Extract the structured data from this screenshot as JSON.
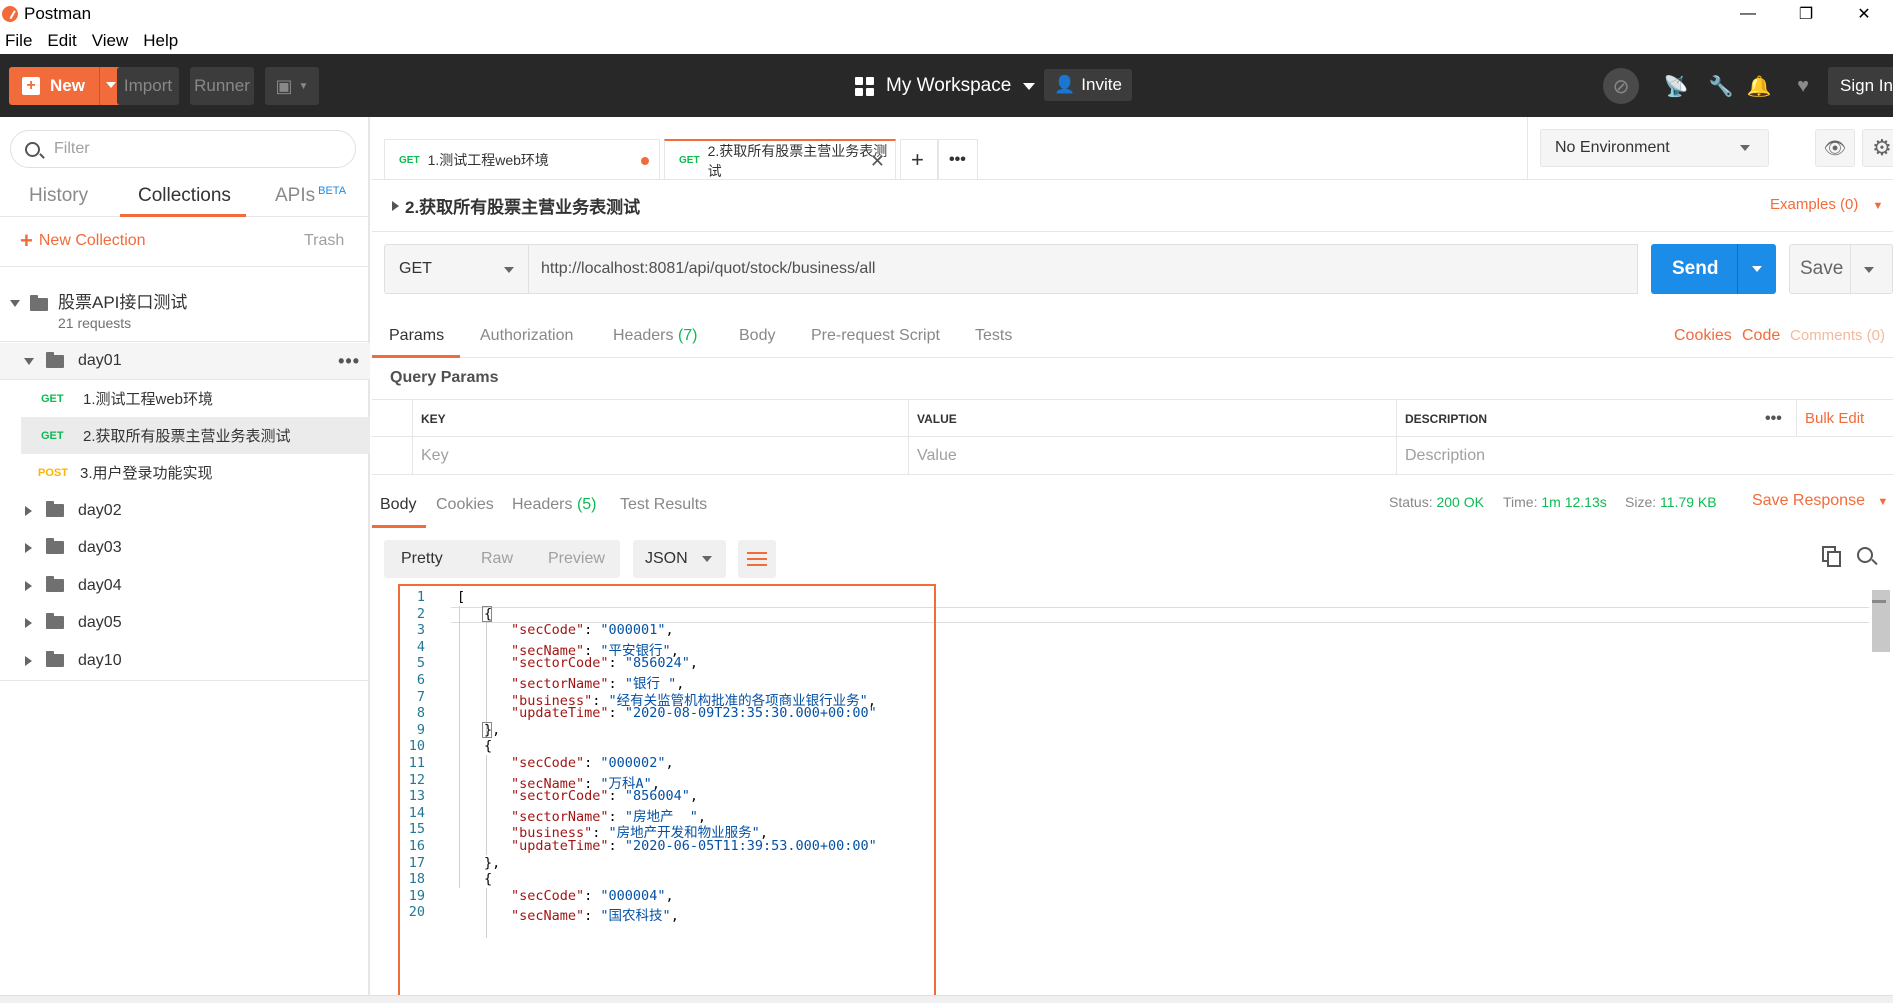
{
  "window": {
    "title": "Postman",
    "minimize": "—",
    "restore": "❐",
    "close": "✕"
  },
  "menu": [
    "File",
    "Edit",
    "View",
    "Help"
  ],
  "header": {
    "new_label": "New",
    "import_label": "Import",
    "runner_label": "Runner",
    "workspace_label": "My Workspace",
    "invite_label": "Invite",
    "signin_label": "Sign In"
  },
  "sidebar": {
    "filter_placeholder": "Filter",
    "tabs": [
      "History",
      "Collections",
      "APIs"
    ],
    "beta_badge": "BETA",
    "new_collection_label": "New Collection",
    "trash_label": "Trash",
    "collection": {
      "name": "股票API接口测试",
      "count": "21 requests"
    },
    "folders": [
      {
        "name": "day01",
        "expanded": true,
        "requests": [
          {
            "method": "GET",
            "name": "1.测试工程web环境"
          },
          {
            "method": "GET",
            "name": "2.获取所有股票主营业务表测试"
          },
          {
            "method": "POST",
            "name": "3.用户登录功能实现"
          }
        ]
      },
      {
        "name": "day02"
      },
      {
        "name": "day03"
      },
      {
        "name": "day04"
      },
      {
        "name": "day05"
      },
      {
        "name": "day10"
      }
    ]
  },
  "tabs": [
    {
      "method": "GET",
      "label": "1.测试工程web环境",
      "unsaved": true
    },
    {
      "method": "GET",
      "label": "2.获取所有股票主营业务表测试",
      "active": true
    }
  ],
  "environment": {
    "selected": "No Environment"
  },
  "request": {
    "name": "2.获取所有股票主营业务表测试",
    "examples_label": "Examples (0)",
    "method": "GET",
    "url": "http://localhost:8081/api/quot/stock/business/all",
    "send_label": "Send",
    "save_label": "Save",
    "tabs": [
      "Params",
      "Authorization",
      "Headers",
      "Body",
      "Pre-request Script",
      "Tests"
    ],
    "headers_count": "(7)",
    "right_links": [
      "Cookies",
      "Code",
      "Comments (0)"
    ],
    "query_params_title": "Query Params",
    "columns": [
      "KEY",
      "VALUE",
      "DESCRIPTION"
    ],
    "bulk_edit": "Bulk Edit",
    "placeholders": [
      "Key",
      "Value",
      "Description"
    ]
  },
  "response": {
    "tabs": [
      "Body",
      "Cookies",
      "Headers",
      "Test Results"
    ],
    "headers_count": "(5)",
    "status_label": "Status:",
    "status_value": "200 OK",
    "time_label": "Time:",
    "time_value": "1m 12.13s",
    "size_label": "Size:",
    "size_value": "11.79 KB",
    "save_response": "Save Response",
    "formats": [
      "Pretty",
      "Raw",
      "Preview"
    ],
    "language": "JSON",
    "lines": [
      {
        "n": "1",
        "i": 0,
        "t": "["
      },
      {
        "n": "2",
        "i": 1,
        "t": "{"
      },
      {
        "n": "3",
        "i": 2,
        "k": "\"secCode\"",
        "v": "\"000001\"",
        "c": ","
      },
      {
        "n": "4",
        "i": 2,
        "k": "\"secName\"",
        "v": "\"平安银行\"",
        "c": ","
      },
      {
        "n": "5",
        "i": 2,
        "k": "\"sectorCode\"",
        "v": "\"856024\"",
        "c": ","
      },
      {
        "n": "6",
        "i": 2,
        "k": "\"sectorName\"",
        "v": "\"银行 \"",
        "c": ","
      },
      {
        "n": "7",
        "i": 2,
        "k": "\"business\"",
        "v": "\"经有关监管机构批准的各项商业银行业务\"",
        "c": ","
      },
      {
        "n": "8",
        "i": 2,
        "k": "\"updateTime\"",
        "v": "\"2020-08-09T23:35:30.000+00:00\"",
        "c": ""
      },
      {
        "n": "9",
        "i": 1,
        "t": "},"
      },
      {
        "n": "10",
        "i": 1,
        "t": "{"
      },
      {
        "n": "11",
        "i": 2,
        "k": "\"secCode\"",
        "v": "\"000002\"",
        "c": ","
      },
      {
        "n": "12",
        "i": 2,
        "k": "\"secName\"",
        "v": "\"万科A\"",
        "c": ","
      },
      {
        "n": "13",
        "i": 2,
        "k": "\"sectorCode\"",
        "v": "\"856004\"",
        "c": ","
      },
      {
        "n": "14",
        "i": 2,
        "k": "\"sectorName\"",
        "v": "\"房地产  \"",
        "c": ","
      },
      {
        "n": "15",
        "i": 2,
        "k": "\"business\"",
        "v": "\"房地产开发和物业服务\"",
        "c": ","
      },
      {
        "n": "16",
        "i": 2,
        "k": "\"updateTime\"",
        "v": "\"2020-06-05T11:39:53.000+00:00\"",
        "c": ""
      },
      {
        "n": "17",
        "i": 1,
        "t": "},"
      },
      {
        "n": "18",
        "i": 1,
        "t": "{"
      },
      {
        "n": "19",
        "i": 2,
        "k": "\"secCode\"",
        "v": "\"000004\"",
        "c": ","
      },
      {
        "n": "20",
        "i": 2,
        "k": "\"secName\"",
        "v": "\"国农科技\"",
        "c": ","
      }
    ]
  },
  "colors": {
    "accent": "#f26b3a",
    "send": "#1b8ce8",
    "get": "#0cbb52",
    "post": "#ffb400",
    "appbar": "#282828"
  }
}
